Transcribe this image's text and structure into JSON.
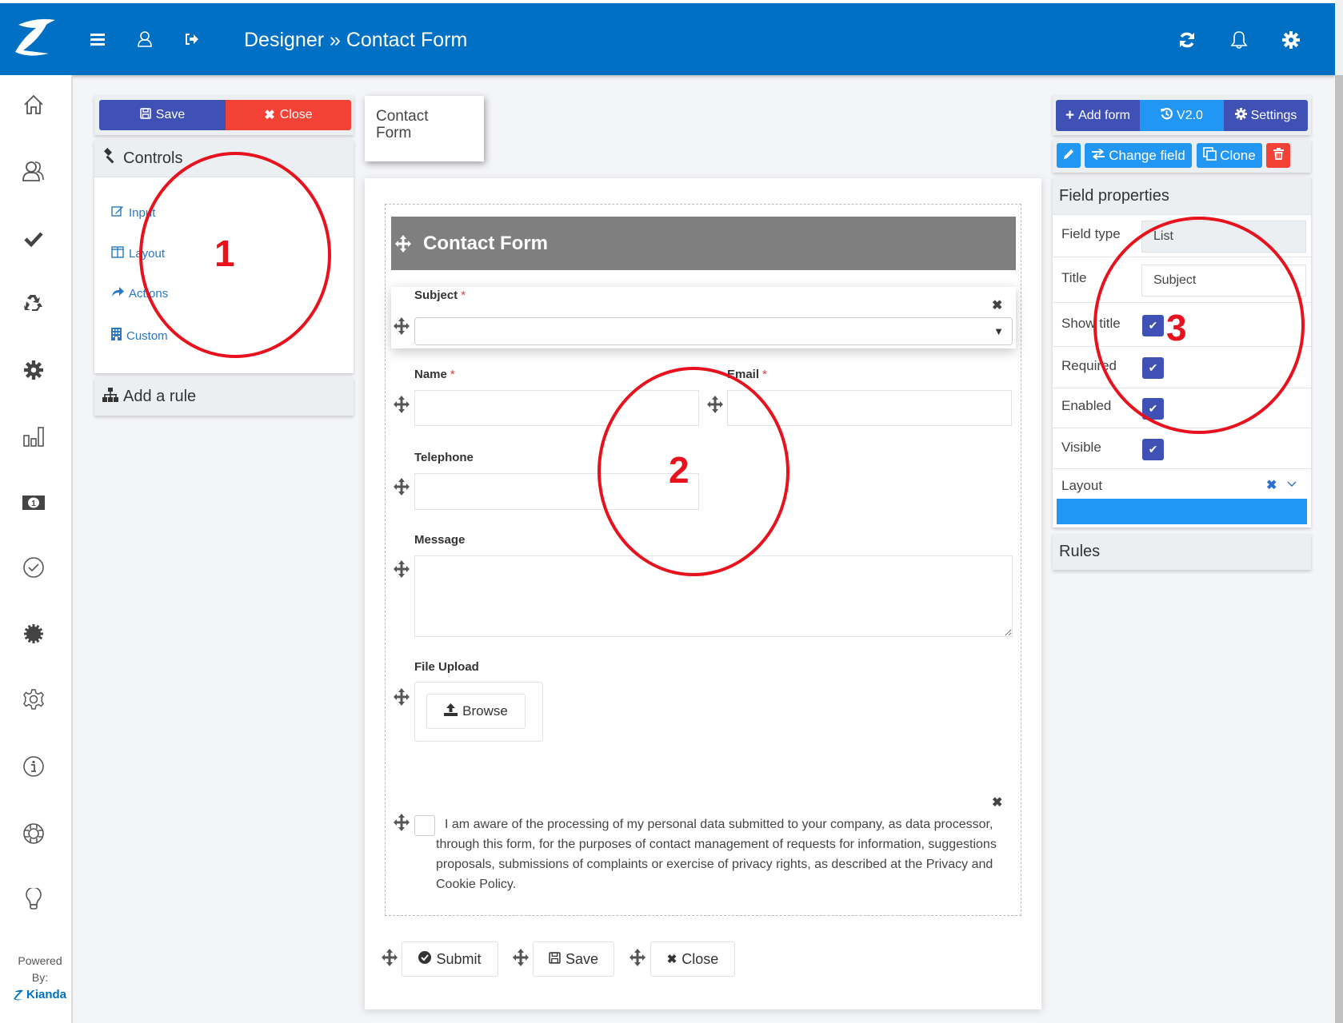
{
  "header": {
    "title": "Designer » Contact Form",
    "icons": [
      "logo",
      "menu-icon",
      "user-icon",
      "sign-out-icon",
      "refresh-icon",
      "bell-icon",
      "gear-icon"
    ]
  },
  "sidebar": {
    "items": [
      "home",
      "users",
      "tasks",
      "recycle",
      "settings",
      "reports",
      "billing",
      "approvals",
      "badge",
      "preferences",
      "info",
      "help",
      "ideas"
    ],
    "powered_line1": "Powered",
    "powered_line2": "By:",
    "brand": "Kianda"
  },
  "left_panel": {
    "save_label": "Save",
    "close_label": "Close",
    "controls_title": "Controls",
    "controls": [
      {
        "label": "Input",
        "icon": "edit-icon"
      },
      {
        "label": "Layout",
        "icon": "columns-icon"
      },
      {
        "label": "Actions",
        "icon": "share-icon"
      },
      {
        "label": "Custom",
        "icon": "building-icon"
      }
    ],
    "add_rule_label": "Add a rule"
  },
  "form_tab": {
    "label_line1": "Contact",
    "label_line2": "Form"
  },
  "form": {
    "header_title": "Contact Form",
    "fields": {
      "subject": {
        "label": "Subject",
        "required": "*",
        "value": ""
      },
      "name": {
        "label": "Name",
        "required": "*",
        "value": ""
      },
      "email": {
        "label": "Email",
        "required": "*",
        "value": ""
      },
      "telephone": {
        "label": "Telephone",
        "value": ""
      },
      "message": {
        "label": "Message",
        "value": ""
      },
      "file_upload": {
        "label": "File Upload",
        "button": "Browse"
      }
    },
    "consent_text": "I am aware of the processing of my personal data submitted to your company, as data processor, through this form, for the purposes of contact management of requests for information, suggestions proposals, submissions of complaints or exercise of privacy rights, as described at the Privacy and Cookie Policy.",
    "consent_checked": false,
    "buttons": {
      "submit": "Submit",
      "save": "Save",
      "close": "Close"
    }
  },
  "right_panel": {
    "add_form_label": "Add form",
    "version_label": "V2.0",
    "settings_label": "Settings",
    "change_field_label": "Change field",
    "clone_label": "Clone",
    "field_properties_title": "Field properties",
    "properties": {
      "field_type_label": "Field type",
      "field_type_value": "List",
      "title_label": "Title",
      "title_value": "Subject",
      "show_title_label": "Show title",
      "show_title": true,
      "required_label": "Required",
      "required": true,
      "enabled_label": "Enabled",
      "enabled": true,
      "visible_label": "Visible",
      "visible": true,
      "layout_label": "Layout"
    },
    "rules_title": "Rules"
  },
  "annotations": {
    "one": "1",
    "two": "2",
    "three": "3"
  },
  "colors": {
    "header_blue": "#0070c4",
    "indigo": "#3f51b5",
    "light_blue": "#2196f3",
    "red": "#f44336",
    "annotation_red": "#e8121e"
  }
}
